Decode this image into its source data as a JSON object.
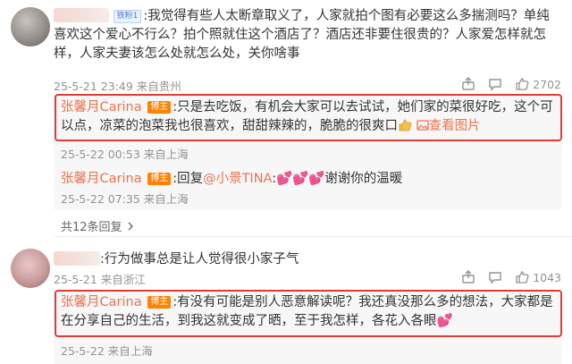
{
  "comments": [
    {
      "badge": "铁粉1",
      "text": ":我觉得有些人太断章取义了，人家就拍个图有必要这么多揣测吗？单纯喜欢这个爱心不行么？拍个照就住这个酒店了？酒店还非要住很贵的？人家爱怎样就怎样，人家夫妻该怎么处就怎么处，关你啥事",
      "meta": "25-5-21 23:49 来自贵州",
      "likes": "2702",
      "replies": [
        {
          "name": "张馨月Carina",
          "op_badge": "博主",
          "text": ":只是去吃饭，有机会大家可以去试试，她们家的菜很好吃，这个可以点，凉菜的泡菜我也很喜欢，甜甜辣辣的，脆脆的很爽口",
          "view_pic": "查看图片",
          "meta": "25-5-22 00:53 来自上海"
        },
        {
          "name": "张馨月Carina",
          "op_badge": "博主",
          "text_prefix": ":回复",
          "mention": "@小景TINA",
          "text_suffix": ":",
          "text_end": "谢谢你的温暖",
          "meta": "25-5-22 07:35 来自上海"
        }
      ],
      "more_replies": "共12条回复"
    },
    {
      "text": ":行为做事总是让人觉得很小家子气",
      "meta": "25-5-21 来自浙江",
      "likes": "1043",
      "replies": [
        {
          "name": "张馨月Carina",
          "op_badge": "博主",
          "text": ":有没有可能是别人恶意解读呢？我还真没那么多的想法，大家都是在分享自己的生活，到我这就变成了晒，至于我怎样，各花入各眼",
          "meta": "25-5-22 来自上海"
        }
      ]
    }
  ],
  "colors": {
    "username": "#eb7350",
    "highlight_frame": "#e23b34",
    "meta": "#939393",
    "reply_bg": "#f7f7f7"
  }
}
